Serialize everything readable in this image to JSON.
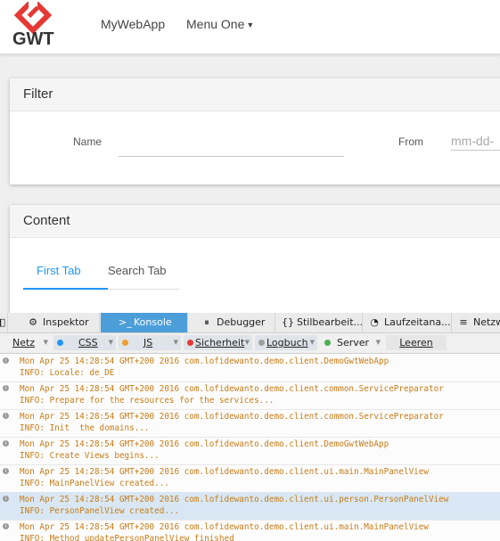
{
  "header": {
    "logo_text": "GWT",
    "brand": "MyWebApp",
    "menu_one": "Menu One"
  },
  "filter": {
    "title": "Filter",
    "name_label": "Name",
    "from_label": "From",
    "from_placeholder": "mm-dd-"
  },
  "content": {
    "title": "Content",
    "tabs": [
      "First Tab",
      "Search Tab"
    ]
  },
  "devtools": {
    "tabs": [
      "Inspektor",
      "Konsole",
      "Debugger",
      "Stilbearbeit...",
      "Laufzeitana...",
      "Netzw"
    ],
    "filters": {
      "netz": "Netz",
      "css": "CSS",
      "js": "JS",
      "sicherheit": "Sicherheit",
      "logbuch": "Logbuch",
      "server": "Server",
      "leeren": "Leeren"
    },
    "logs": [
      {
        "header": "Mon Apr 25 14:28:54 GMT+200 2016 com.lofidewanto.demo.client.DemoGwtWebApp",
        "message": "INFO: Locale: de_DE"
      },
      {
        "header": "Mon Apr 25 14:28:54 GMT+200 2016 com.lofidewanto.demo.client.common.ServicePreparator",
        "message": "INFO: Prepare for the resources for the services..."
      },
      {
        "header": "Mon Apr 25 14:28:54 GMT+200 2016 com.lofidewanto.demo.client.common.ServicePreparator",
        "message": "INFO: Init  the domains..."
      },
      {
        "header": "Mon Apr 25 14:28:54 GMT+200 2016 com.lofidewanto.demo.client.DemoGwtWebApp",
        "message": "INFO: Create Views begins..."
      },
      {
        "header": "Mon Apr 25 14:28:54 GMT+200 2016 com.lofidewanto.demo.client.ui.main.MainPanelView",
        "message": "INFO: MainPanelView created..."
      },
      {
        "header": "Mon Apr 25 14:28:54 GMT+200 2016 com.lofidewanto.demo.client.ui.person.PersonPanelView",
        "message": "INFO: PersonPanelView created..."
      },
      {
        "header": "Mon Apr 25 14:28:54 GMT+200 2016 com.lofidewanto.demo.client.ui.main.MainPanelView",
        "message": "INFO: Method updatePersonPanelView finished"
      }
    ]
  },
  "colors": {
    "accent": "#2196f3",
    "logo_red": "#e53935",
    "active_devtools_tab": "#4c9ed9",
    "log_text": "#c77c18",
    "highlight_row": "#d8e7f3",
    "css_dot": "#2196f3",
    "js_dot": "#f0a030",
    "security_dot": "#e53935",
    "logbuch_dot": "#9e9e9e",
    "server_dot": "#4caf50"
  },
  "icons": {
    "logo": "gwt-logo-icon",
    "menu": "caret-down-icon",
    "inspector": "gear-icon",
    "console": "terminal-icon",
    "debugger": "pause-icon",
    "style_editor": "braces-icon",
    "performance": "gauge-icon",
    "network": "network-icon",
    "log_entry": "info-icon"
  }
}
